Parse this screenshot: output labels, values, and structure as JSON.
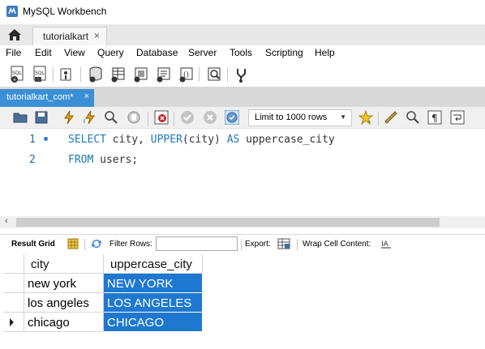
{
  "window": {
    "title": "MySQL Workbench"
  },
  "connection_tab": {
    "label": "tutorialkart",
    "close": "×"
  },
  "menu": [
    "File",
    "Edit",
    "View",
    "Query",
    "Database",
    "Server",
    "Tools",
    "Scripting",
    "Help"
  ],
  "toolbar_icons": [
    "new-sql-tab-icon",
    "open-sql-file-icon",
    "inspector-icon",
    "create-schema-icon",
    "create-table-icon",
    "create-view-icon",
    "create-procedure-icon",
    "create-function-icon",
    "search-table-data-icon",
    "reconnect-icon"
  ],
  "editor_tab": {
    "label": "tutorialkart_com*",
    "close": "×"
  },
  "editor_toolbar": {
    "icons": [
      "open-folder-icon",
      "save-icon",
      "execute-icon",
      "execute-current-icon",
      "explain-icon",
      "stop-icon",
      "toggle-error-icon",
      "commit-icon",
      "rollback-icon",
      "autocommit-icon",
      "beautify-icon",
      "find-icon",
      "invisibles-icon",
      "wrap-icon"
    ],
    "limit_label": "Limit to 1000 rows"
  },
  "editor": {
    "lines": [
      {
        "number": "1",
        "tokens": [
          {
            "text": "SELECT",
            "kind": "kw"
          },
          {
            "text": " city, ",
            "kind": "plain"
          },
          {
            "text": "UPPER",
            "kind": "fn"
          },
          {
            "text": "(city) ",
            "kind": "plain"
          },
          {
            "text": "AS",
            "kind": "kw"
          },
          {
            "text": " uppercase_city",
            "kind": "plain"
          }
        ]
      },
      {
        "number": "2",
        "tokens": [
          {
            "text": "FROM",
            "kind": "kw"
          },
          {
            "text": " users;",
            "kind": "plain"
          }
        ]
      }
    ]
  },
  "result_toolbar": {
    "result_grid": "Result Grid",
    "filter_rows": "Filter Rows:",
    "filter_value": "",
    "export": "Export:",
    "wrap_cell_content": "Wrap Cell Content:"
  },
  "result_grid": {
    "columns": [
      "city",
      "uppercase_city"
    ],
    "rows": [
      [
        "new york",
        "NEW YORK"
      ],
      [
        "los angeles",
        "LOS ANGELES"
      ],
      [
        "chicago",
        "CHICAGO"
      ]
    ],
    "current_row_index": 2
  },
  "colors": {
    "accent": "#3b8fd6",
    "selection": "#1e78d0",
    "keyword": "#1f78b4"
  }
}
